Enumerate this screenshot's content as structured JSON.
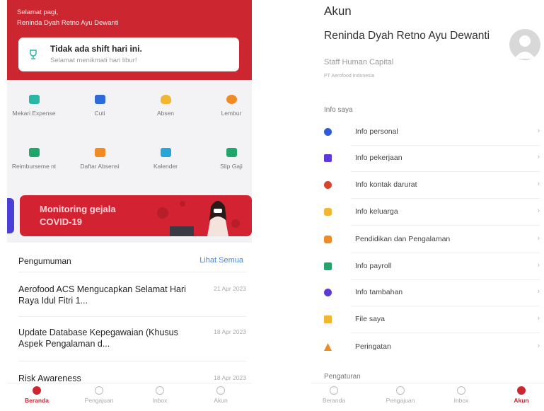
{
  "left": {
    "greeting_line1": "Selamat pagi,",
    "greeting_line2": "Reninda Dyah Retno Ayu Dewanti",
    "shift_title": "Tidak ada shift hari ini.",
    "shift_subtitle": "Selamat menikmati hari libur!",
    "menu": [
      {
        "label": "Mekari Expense",
        "icon": "expense-icon",
        "color": "#2bb5a6"
      },
      {
        "label": "Cuti",
        "icon": "calendar-icon",
        "color": "#2e6bd6"
      },
      {
        "label": "Absen",
        "icon": "fingerprint-icon",
        "color": "#f2b632"
      },
      {
        "label": "Lembur",
        "icon": "clock-icon",
        "color": "#f08a24"
      },
      {
        "label": "Reimburseme nt",
        "icon": "reimburse-icon",
        "color": "#20a66a"
      },
      {
        "label": "Daftar Absensi",
        "icon": "list-icon",
        "color": "#f08a24"
      },
      {
        "label": "Kalender",
        "icon": "calendar-icon",
        "color": "#2aa3d6"
      },
      {
        "label": "Slip Gaji",
        "icon": "payslip-icon",
        "color": "#20a66a"
      }
    ],
    "banner_text_1": "Monitoring gejala",
    "banner_text_2": "COVID-19",
    "announcements_title": "Pengumuman",
    "see_all": "Lihat Semua",
    "announcements": [
      {
        "title": "Aerofood ACS Mengucapkan Selamat Hari Raya Idul Fitri 1...",
        "date": "21 Apr 2023"
      },
      {
        "title": "Update Database Kepegawaian (Khusus Aspek Pengalaman d...",
        "date": "18 Apr 2023"
      },
      {
        "title": "Risk Awareness",
        "date": "18 Apr 2023"
      }
    ],
    "nav": [
      {
        "label": "Beranda",
        "active": true
      },
      {
        "label": "Pengajuan",
        "active": false
      },
      {
        "label": "Inbox",
        "active": false
      },
      {
        "label": "Akun",
        "active": false
      }
    ]
  },
  "right": {
    "title": "Akun",
    "name": "Reninda Dyah Retno Ayu Dewanti",
    "role": "Staff Human Capital",
    "company": "PT Aerofood Indonesia",
    "info_section": "Info saya",
    "items": [
      {
        "label": "Info personal",
        "icon": "person-icon",
        "color": "#2e5bd6"
      },
      {
        "label": "Info pekerjaan",
        "icon": "briefcase-icon",
        "color": "#5b3ad6"
      },
      {
        "label": "Info kontak darurat",
        "icon": "emergency-icon",
        "color": "#d8432e"
      },
      {
        "label": "Info keluarga",
        "icon": "family-icon",
        "color": "#f2b632"
      },
      {
        "label": "Pendidikan dan Pengalaman",
        "icon": "education-icon",
        "color": "#f08a24"
      },
      {
        "label": "Info payroll",
        "icon": "payroll-icon",
        "color": "#20a66a"
      },
      {
        "label": "Info tambahan",
        "icon": "info-icon",
        "color": "#5b3ad6"
      },
      {
        "label": "File saya",
        "icon": "folder-icon",
        "color": "#f2b632"
      },
      {
        "label": "Peringatan",
        "icon": "warning-icon",
        "color": "#f08a24"
      }
    ],
    "settings_section": "Pengaturan",
    "nav": [
      {
        "label": "Beranda",
        "active": false
      },
      {
        "label": "Pengajuan",
        "active": false
      },
      {
        "label": "Inbox",
        "active": false
      },
      {
        "label": "Akun",
        "active": true
      }
    ]
  }
}
